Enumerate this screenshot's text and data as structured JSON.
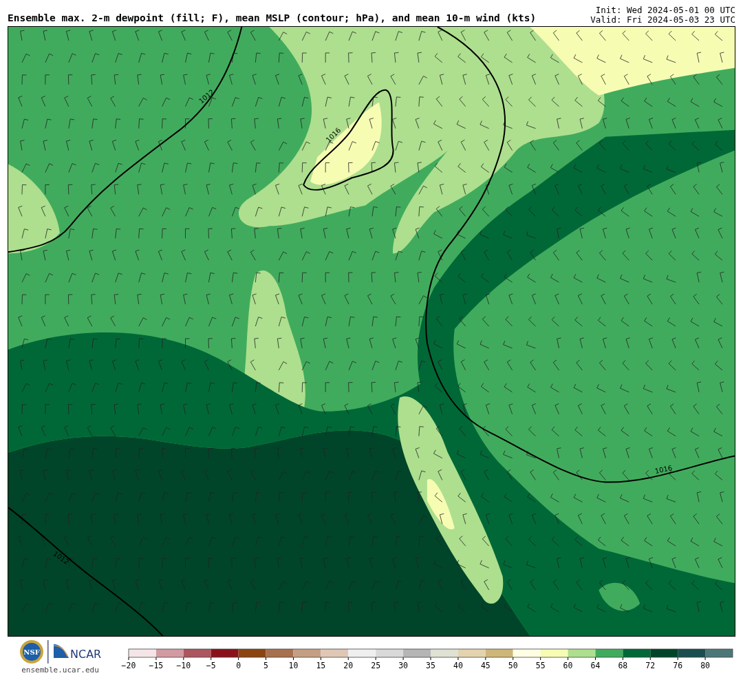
{
  "title": "Ensemble max. 2-m dewpoint (fill; F), mean MSLP (contour; hPa), and mean 10-m wind (kts)",
  "init": "Init: Wed 2024-05-01 00 UTC",
  "valid": "Valid: Fri 2024-05-03 23 UTC",
  "contours": [
    {
      "label": "1012"
    },
    {
      "label": "1016"
    },
    {
      "label": "1016"
    },
    {
      "label": "1012"
    }
  ],
  "logo": {
    "nsf": "NSF",
    "ncar": "NCAR",
    "site": "ensemble.ucar.edu"
  },
  "colorbar": {
    "segments": [
      {
        "color": "#f4e6e8"
      },
      {
        "color": "#d19ba1"
      },
      {
        "color": "#ac565d"
      },
      {
        "color": "#8a111c"
      },
      {
        "color": "#8a4511"
      },
      {
        "color": "#a7704f"
      },
      {
        "color": "#c59f83"
      },
      {
        "color": "#e0c7b5"
      },
      {
        "color": "#efefef"
      },
      {
        "color": "#d9d9d9"
      },
      {
        "color": "#b5b5b5"
      },
      {
        "color": "#dfe1d3"
      },
      {
        "color": "#e3d3ae"
      },
      {
        "color": "#ceb67a"
      },
      {
        "color": "#fdfee4"
      },
      {
        "color": "#f7fcb3"
      },
      {
        "color": "#addf8e"
      },
      {
        "color": "#41ab5d"
      },
      {
        "color": "#006837"
      },
      {
        "color": "#004529"
      },
      {
        "color": "#1a4d50"
      },
      {
        "color": "#4b7778"
      }
    ],
    "ticks": [
      "−20",
      "−15",
      "−10",
      "−5",
      "0",
      "5",
      "10",
      "15",
      "20",
      "25",
      "30",
      "35",
      "40",
      "45",
      "50",
      "55",
      "60",
      "64",
      "68",
      "72",
      "76",
      "80"
    ]
  }
}
